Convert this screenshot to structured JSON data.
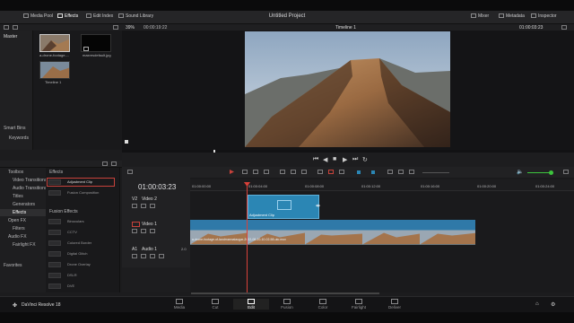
{
  "app": {
    "title": "Untitled Project",
    "brand": "DaVinci Resolve 18"
  },
  "topbar": {
    "media_pool": "Media Pool",
    "effects": "Effects",
    "edit_index": "Edit Index",
    "sound_library": "Sound Library",
    "mixer": "Mixer",
    "metadata": "Metadata",
    "inspector": "Inspector"
  },
  "viewer_bar": {
    "zoom": "39%",
    "source_tc": "00:00:19:22",
    "timeline_name": "Timeline 1",
    "record_tc": "01:00:03:23"
  },
  "bins": {
    "master": "Master",
    "smart_bins": "Smart Bins",
    "keywords": "Keywords"
  },
  "media": [
    {
      "name": "a-drone-footage-..."
    },
    {
      "name": "maxresdefault.jpg"
    },
    {
      "name": "Timeline 1"
    }
  ],
  "effects_library": {
    "items": [
      {
        "label": "Toolbox"
      },
      {
        "label": "Video Transitions"
      },
      {
        "label": "Audio Transitions"
      },
      {
        "label": "Titles"
      },
      {
        "label": "Generators"
      },
      {
        "label": "Effects"
      },
      {
        "label": "Open FX"
      },
      {
        "label": "Filters"
      },
      {
        "label": "Audio FX"
      },
      {
        "label": "Fairlight FX"
      }
    ],
    "favorites": "Favorites"
  },
  "effects_list": {
    "section1": "Effects",
    "items1": [
      "Adjustment Clip",
      "Fusion Composition"
    ],
    "section2": "Fusion Effects",
    "items2": [
      "Binoculars",
      "CCTV",
      "Colored Border",
      "Digital Glitch",
      "Drone Overlay",
      "DSLR",
      "DVE"
    ]
  },
  "timeline": {
    "timecode": "01:00:03:23",
    "ruler": [
      "01:00:00:00",
      "01:00:04:00",
      "01:00:08:00",
      "01:00:12:00",
      "01:00:16:00",
      "01:00:20:00",
      "01:00:24:00"
    ],
    "tracks": [
      {
        "id": "V2",
        "name": "Video 2"
      },
      {
        "id": "V1",
        "name": "Video 1"
      },
      {
        "id": "A1",
        "name": "Audio 1",
        "level": "2.0"
      }
    ],
    "adjustment_clip": "Adjustment Clip",
    "video_clip": "a-drone-footage-of-landmannalaugar-2022-08-20-10-02-58-utc.mov"
  },
  "pages": [
    {
      "label": "Media"
    },
    {
      "label": "Cut"
    },
    {
      "label": "Edit"
    },
    {
      "label": "Fusion"
    },
    {
      "label": "Color"
    },
    {
      "label": "Fairlight"
    },
    {
      "label": "Deliver"
    }
  ],
  "colors": {
    "accent_red": "#c8423b",
    "clip_blue": "#2f79a8",
    "adjust_blue": "#2b86b4",
    "audio_green": "#3dc53d"
  }
}
